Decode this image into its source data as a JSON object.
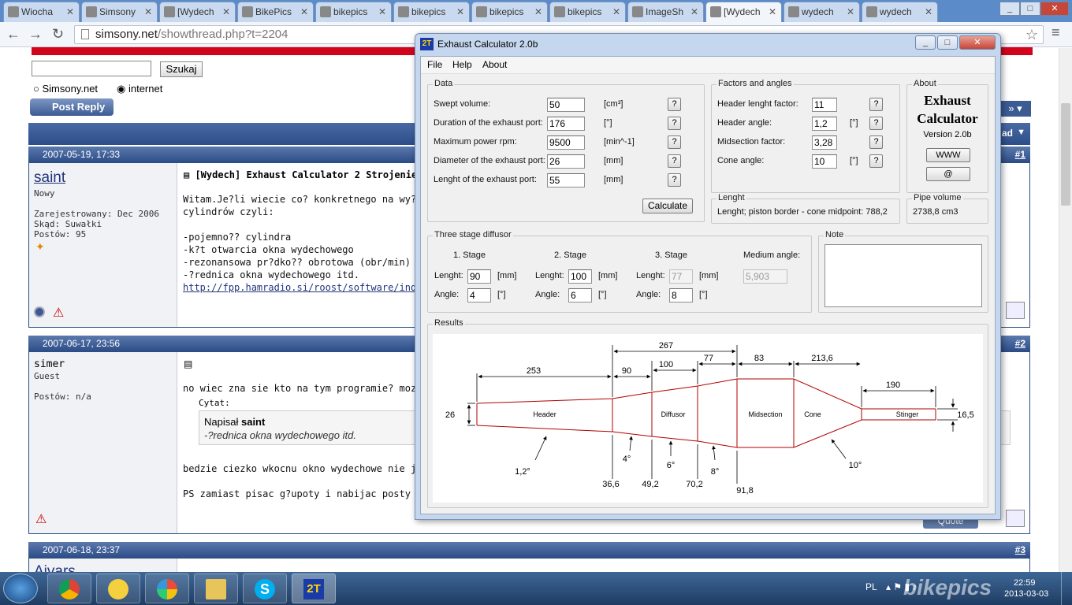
{
  "browser": {
    "tabs": [
      {
        "label": "Wiocha",
        "active": false
      },
      {
        "label": "Simsony",
        "active": false
      },
      {
        "label": "[Wydech",
        "active": false
      },
      {
        "label": "BikePics",
        "active": false
      },
      {
        "label": "bikepics",
        "active": false
      },
      {
        "label": "bikepics",
        "active": false
      },
      {
        "label": "bikepics",
        "active": false
      },
      {
        "label": "bikepics",
        "active": false
      },
      {
        "label": "ImageSh",
        "active": false
      },
      {
        "label": "[Wydech",
        "active": true
      },
      {
        "label": "wydech",
        "active": false
      },
      {
        "label": "wydech",
        "active": false
      }
    ],
    "url_host": "simsony.net",
    "url_path": "/showthread.php?t=2204"
  },
  "forum": {
    "search_button": "Szukaj",
    "radio_site": "Simsony.net",
    "radio_internet": "internet",
    "post_reply": "Post Reply",
    "header_right": "ad",
    "posts": [
      {
        "date": "2007-05-19, 17:33",
        "num": "#1",
        "user": "saint",
        "rank": "Nowy",
        "joined": "Zarejestrowany: Dec 2006",
        "from": "Skąd: Suwałki",
        "posts": "Postów: 95",
        "title": "[Wydech] Exhaust Calculator 2 Strojenie W",
        "body": "Witam.Je?li wiecie co? konkretnego na wy?ej\ncylindrów czyli:\n\n-pojemno?? cylindra\n-k?t otwarcia okna wydechowego\n-rezonansowa pr?dko?? obrotowa (obr/min) -\n-?rednica okna wydechowego itd.",
        "link": "http://fpp.hamradio.si/roost/software/index."
      },
      {
        "date": "2007-06-17, 23:56",
        "num": "#2",
        "user": "simer",
        "rank": "Guest",
        "posts": "Postów: n/a",
        "body1": "no wiec zna sie kto na tym programie? moze",
        "quote_label": "Cytat:",
        "quote_prefix": "Napisał",
        "quote_author": "saint",
        "quote_text": "-?rednica okna wydechowego itd.",
        "body2": "bedzie ciezko wkocnu okno wydechowe nie j",
        "body3": "PS zamiast pisac g?upoty i nabijac posty sar",
        "quote_button": "Quote"
      },
      {
        "date": "2007-06-18, 23:37",
        "num": "#3",
        "user": "Aivars"
      }
    ]
  },
  "app": {
    "title": "Exhaust Calculator 2.0b",
    "icon_text": "2T",
    "menu": [
      "File",
      "Help",
      "About"
    ],
    "data_group": "Data",
    "fields": [
      {
        "label": "Swept volume:",
        "value": "50",
        "unit": "[cm³]"
      },
      {
        "label": "Duration of the exhaust port:",
        "value": "176",
        "unit": "[°]"
      },
      {
        "label": "Maximum power rpm:",
        "value": "9500",
        "unit": "[min^-1]"
      },
      {
        "label": "Diameter of the exhaust port:",
        "value": "26",
        "unit": "[mm]"
      },
      {
        "label": "Lenght of the exhaust port:",
        "value": "55",
        "unit": "[mm]"
      }
    ],
    "help_glyph": "?",
    "calculate": "Calculate",
    "factors_group": "Factors and angles",
    "factors": [
      {
        "label": "Header lenght factor:",
        "value": "11",
        "unit": ""
      },
      {
        "label": "Header angle:",
        "value": "1,2",
        "unit": "[°]"
      },
      {
        "label": "Midsection factor:",
        "value": "3,28",
        "unit": ""
      },
      {
        "label": "Cone angle:",
        "value": "10",
        "unit": "[°]"
      }
    ],
    "about_group": "About",
    "about_title1": "Exhaust",
    "about_title2": "Calculator",
    "about_version": "Version 2.0b",
    "www_button": "WWW",
    "email_button": "@",
    "lenght_group": "Lenght",
    "lenght_text": "Lenght; piston border - cone midpoint:  788,2",
    "pipe_group": "Pipe volume",
    "pipe_value": "2738,8 cm3",
    "diffuser_group": "Three stage diffusor",
    "stages": [
      {
        "name": "1. Stage",
        "lenght": "90",
        "angle": "4"
      },
      {
        "name": "2. Stage",
        "lenght": "100",
        "angle": "6"
      },
      {
        "name": "3. Stage",
        "lenght": "77",
        "angle": "8"
      }
    ],
    "lenght_label": "Lenght:",
    "angle_label": "Angle:",
    "mm_unit": "[mm]",
    "deg_unit": "[°]",
    "medium_angle_label": "Medium angle:",
    "medium_angle_value": "5,903",
    "note_group": "Note",
    "note_value": "",
    "results_group": "Results",
    "diagram": {
      "sections": [
        "Header",
        "Diffusor",
        "Midsection",
        "Cone",
        "Stinger"
      ],
      "top_dims": [
        "253",
        "90",
        "100",
        "77",
        "83",
        "213,6",
        "190"
      ],
      "span_dim": "267",
      "left_dia": "26",
      "right_dia": "16,5",
      "diameters": [
        "36,6",
        "49,2",
        "70,2",
        "91,8"
      ],
      "angles": [
        "1,2°",
        "4°",
        "6°",
        "8°",
        "10°"
      ]
    }
  },
  "taskbar": {
    "lang": "PL",
    "time": "22:59",
    "date": "2013-03-03",
    "watermark": "bikepics"
  }
}
